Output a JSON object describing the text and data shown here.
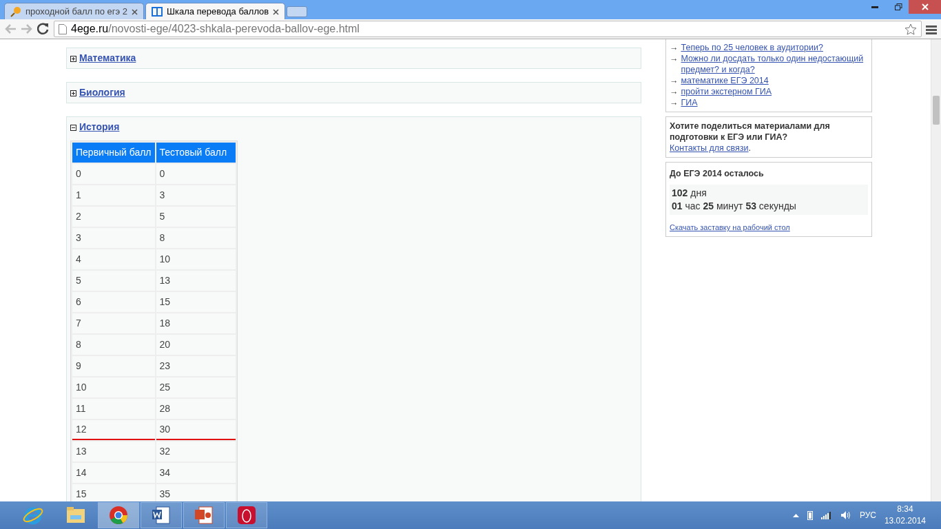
{
  "browser": {
    "tabs": [
      {
        "title": "проходной балл по егэ 2",
        "selected": false
      },
      {
        "title": "Шкала перевода баллов",
        "selected": true
      }
    ],
    "url_host": "4ege.ru",
    "url_path": "/novosti-ege/4023-shkala-perevoda-ballov-ege.html"
  },
  "sections": [
    {
      "title": "Математика",
      "expanded": false
    },
    {
      "title": "Биология",
      "expanded": false
    },
    {
      "title": "История",
      "expanded": true,
      "table": {
        "columns": [
          "Первичный балл",
          "Тестовый балл"
        ],
        "rows": [
          {
            "cells": [
              "0",
              "0"
            ],
            "threshold": false
          },
          {
            "cells": [
              "1",
              "3"
            ],
            "threshold": false
          },
          {
            "cells": [
              "2",
              "5"
            ],
            "threshold": false
          },
          {
            "cells": [
              "3",
              "8"
            ],
            "threshold": false
          },
          {
            "cells": [
              "4",
              "10"
            ],
            "threshold": false
          },
          {
            "cells": [
              "5",
              "13"
            ],
            "threshold": false
          },
          {
            "cells": [
              "6",
              "15"
            ],
            "threshold": false
          },
          {
            "cells": [
              "7",
              "18"
            ],
            "threshold": false
          },
          {
            "cells": [
              "8",
              "20"
            ],
            "threshold": false
          },
          {
            "cells": [
              "9",
              "23"
            ],
            "threshold": false
          },
          {
            "cells": [
              "10",
              "25"
            ],
            "threshold": false
          },
          {
            "cells": [
              "11",
              "28"
            ],
            "threshold": false
          },
          {
            "cells": [
              "12",
              "30"
            ],
            "threshold": true
          },
          {
            "cells": [
              "13",
              "32"
            ],
            "threshold": false
          },
          {
            "cells": [
              "14",
              "34"
            ],
            "threshold": false
          },
          {
            "cells": [
              "15",
              "35"
            ],
            "threshold": false
          }
        ]
      }
    }
  ],
  "sidebar": {
    "links": [
      {
        "arrow": "→",
        "text": "Теперь по 25 человек в аудитории?"
      },
      {
        "arrow": "→",
        "text": "Можно ли досдать только один недостающий предмет? и когда?"
      },
      {
        "arrow": "→",
        "text": "математике ЕГЭ 2014"
      },
      {
        "arrow": "→",
        "text": "пройти экстерном ГИА"
      },
      {
        "arrow": "→",
        "text": "ГИА"
      }
    ],
    "share": {
      "title": "Хотите поделиться материалами для подготовки к ЕГЭ или ГИА?",
      "link": "Контакты для связи",
      "after": "."
    },
    "countdown": {
      "title": "До ЕГЭ 2014 осталось",
      "line1": "**102** дня",
      "line2": "**01** час **25** минут **53** секунды",
      "link": "Скачать заставку на рабочий стол"
    }
  },
  "taskbar": {
    "buttons": [
      {
        "kind": "ie",
        "open": false
      },
      {
        "kind": "explorer",
        "open": false
      },
      {
        "kind": "chrome",
        "open": true
      },
      {
        "kind": "word",
        "open": true
      },
      {
        "kind": "powerpoint",
        "open": true
      },
      {
        "kind": "opera",
        "open": true
      }
    ],
    "language": "РУС",
    "time": "8:34",
    "date": "13.02.2014"
  }
}
